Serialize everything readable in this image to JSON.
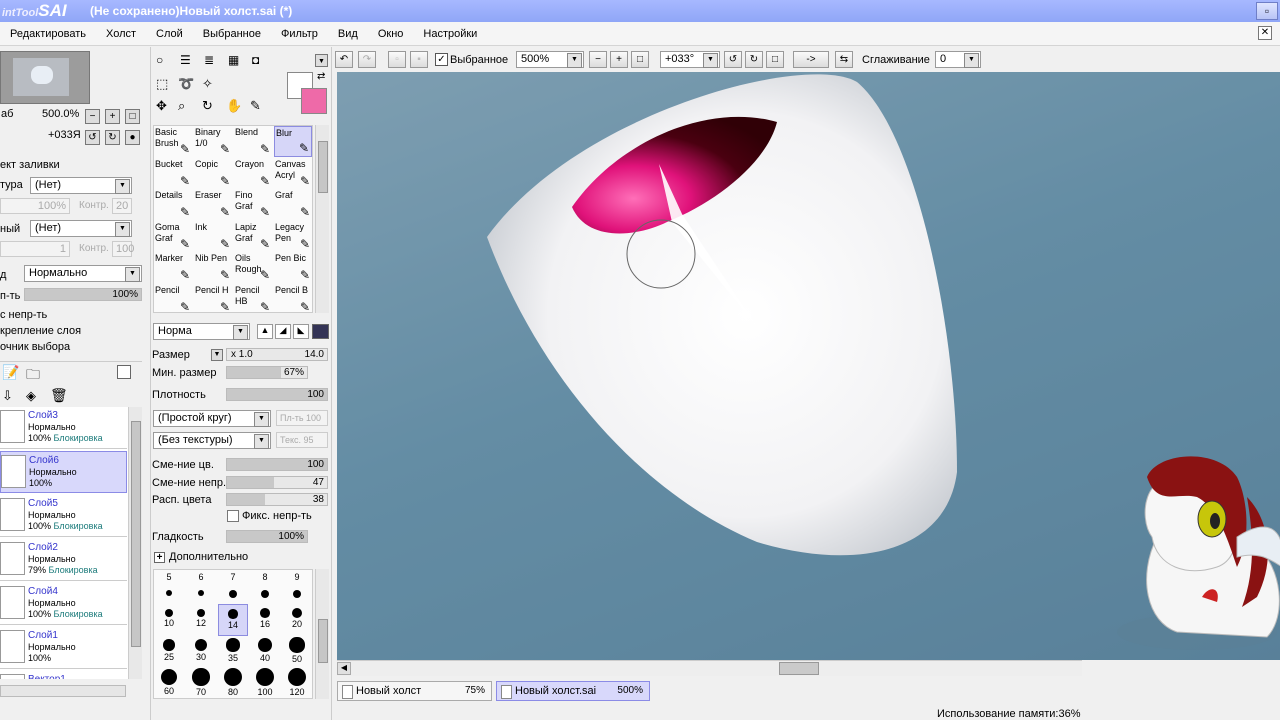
{
  "title": {
    "logo_prefix": "intTool",
    "logo_name": "SAI",
    "document": "(Не сохранено)Новый холст.sai (*)"
  },
  "menu": [
    "Редактировать",
    "Холст",
    "Слой",
    "Выбранное",
    "Фильтр",
    "Вид",
    "Окно",
    "Настройки"
  ],
  "navigator": {
    "zoom_label": "аб",
    "zoom": "500.0%",
    "angle": "+033Я"
  },
  "layer_props": {
    "fill_effect": "ект заливки",
    "texture_label": "тура",
    "texture_value": "(Нет)",
    "texture_scale": "100%",
    "texture_contrast_label": "Контр.",
    "texture_contrast": "20",
    "effect_label": "ный",
    "effect_value": "(Нет)",
    "effect_val": "1",
    "effect_contrast_label": "Контр.",
    "effect_contrast": "100",
    "mode_label": "д",
    "mode_value": "Нормально",
    "opacity_label": "п-ть",
    "opacity": "100%",
    "opacity_fraction": 1.0,
    "chk1": "с непр-ть",
    "chk2": "крепление слоя",
    "chk3": "очник выбора"
  },
  "layers": [
    {
      "name": "Слой3",
      "mode": "Нормально",
      "opacity": "100%",
      "lock": "Блокировка"
    },
    {
      "name": "Слой6",
      "mode": "Нормально",
      "opacity": "100%",
      "lock": ""
    },
    {
      "name": "Слой5",
      "mode": "Нормально",
      "opacity": "100%",
      "lock": "Блокировка"
    },
    {
      "name": "Слой2",
      "mode": "Нормально",
      "opacity": "79%",
      "lock": "Блокировка"
    },
    {
      "name": "Слой4",
      "mode": "Нормально",
      "opacity": "100%",
      "lock": "Блокировка"
    },
    {
      "name": "Слой1",
      "mode": "Нормально",
      "opacity": "100%",
      "lock": ""
    },
    {
      "name": "Вектор1",
      "mode": "",
      "opacity": "",
      "lock": ""
    }
  ],
  "brushes": [
    [
      "Basic Brush",
      "Binary 1/0",
      "Blend",
      "Blur"
    ],
    [
      "Bucket",
      "Copic",
      "Crayon",
      "Canvas Acryl"
    ],
    [
      "Details",
      "Eraser",
      "Fino Graf",
      "Graf"
    ],
    [
      "Goma Graf",
      "Ink",
      "Lapiz Graf",
      "Legacy Pen"
    ],
    [
      "Marker",
      "Nib Pen",
      "Oils Rough",
      "Pen Bic"
    ],
    [
      "Pencil",
      "Pencil H",
      "Pencil HB",
      "Pencil B"
    ]
  ],
  "brush_settings": {
    "blend_mode": "Норма",
    "size_label": "Размер",
    "size_mult": "x 1.0",
    "size_value": "14.0",
    "min_size_label": "Мин. размер",
    "min_size": "67%",
    "min_size_fraction": 0.67,
    "density_label": "Плотность",
    "density": "100",
    "density_fraction": 1.0,
    "shape": "(Простой круг)",
    "shape_strength": "Пл-ть 100",
    "texture": "(Без текстуры)",
    "texture_strength": "Текс.  95",
    "color_blend_label": "Сме-ние цв.",
    "color_blend": "100",
    "color_blend_fraction": 1.0,
    "opacity_blend_label": "Сме-ние непр.",
    "opacity_blend": "47",
    "opacity_blend_fraction": 0.47,
    "color_spread_label": "Расп. цвета",
    "color_spread": "38",
    "color_spread_fraction": 0.38,
    "fix_opacity": "Фикс. непр-ть",
    "smooth_label": "Гладкость",
    "smooth": "100%",
    "smooth_fraction": 1.0,
    "advanced": "Дополнительно"
  },
  "size_presets": [
    [
      "5",
      "6",
      "7",
      "8",
      "9"
    ],
    [
      "10",
      "12",
      "14",
      "16",
      "20"
    ],
    [
      "25",
      "30",
      "35",
      "40",
      "50"
    ],
    [
      "60",
      "70",
      "80",
      "100",
      "120"
    ]
  ],
  "toolbar": {
    "selection_label": "Выбранное",
    "zoom": "500%",
    "angle": "+033°",
    "arrow": "->",
    "smoothing_label": "Сглаживание",
    "smoothing_value": "0"
  },
  "tabs": [
    {
      "name": "Новый холст",
      "zoom": "75%"
    },
    {
      "name": "Новый холст.sai",
      "zoom": "500%"
    }
  ],
  "status": "Использование памяти:36%",
  "colors": {
    "main": "#ffffff",
    "sub": "#ee6aa8",
    "accent": "#8b8be6"
  }
}
